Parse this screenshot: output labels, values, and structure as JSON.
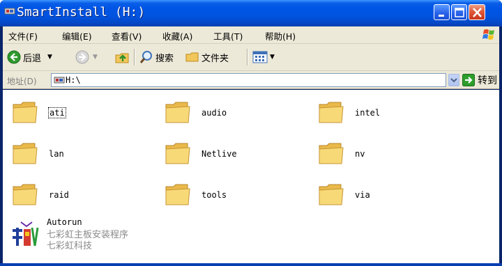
{
  "window": {
    "title": "SmartInstall (H:)"
  },
  "menu": [
    {
      "label": "文件",
      "key": "(F)"
    },
    {
      "label": "编辑",
      "key": "(E)"
    },
    {
      "label": "查看",
      "key": "(V)"
    },
    {
      "label": "收藏",
      "key": "(A)"
    },
    {
      "label": "工具",
      "key": "(T)"
    },
    {
      "label": "帮助",
      "key": "(H)"
    }
  ],
  "toolbar": {
    "back_label": "后退",
    "search_label": "搜索",
    "folders_label": "文件夹"
  },
  "address": {
    "label": "地址(D)",
    "value": "H:\\",
    "go_label": "转到"
  },
  "items": [
    {
      "name": "ati",
      "selected": true
    },
    {
      "name": "audio"
    },
    {
      "name": "intel"
    },
    {
      "name": "lan"
    },
    {
      "name": "Netlive"
    },
    {
      "name": "nv"
    },
    {
      "name": "raid"
    },
    {
      "name": "tools"
    },
    {
      "name": "via"
    }
  ],
  "autorun": {
    "name": "Autorun",
    "desc1": "七彩虹主板安装程序",
    "desc2": "七彩虹科技"
  },
  "colors": {
    "titlebar": "#0154e0",
    "chrome": "#ece9d8",
    "folder": "#f5d36b",
    "go_arrow": "#2c9e2c"
  }
}
